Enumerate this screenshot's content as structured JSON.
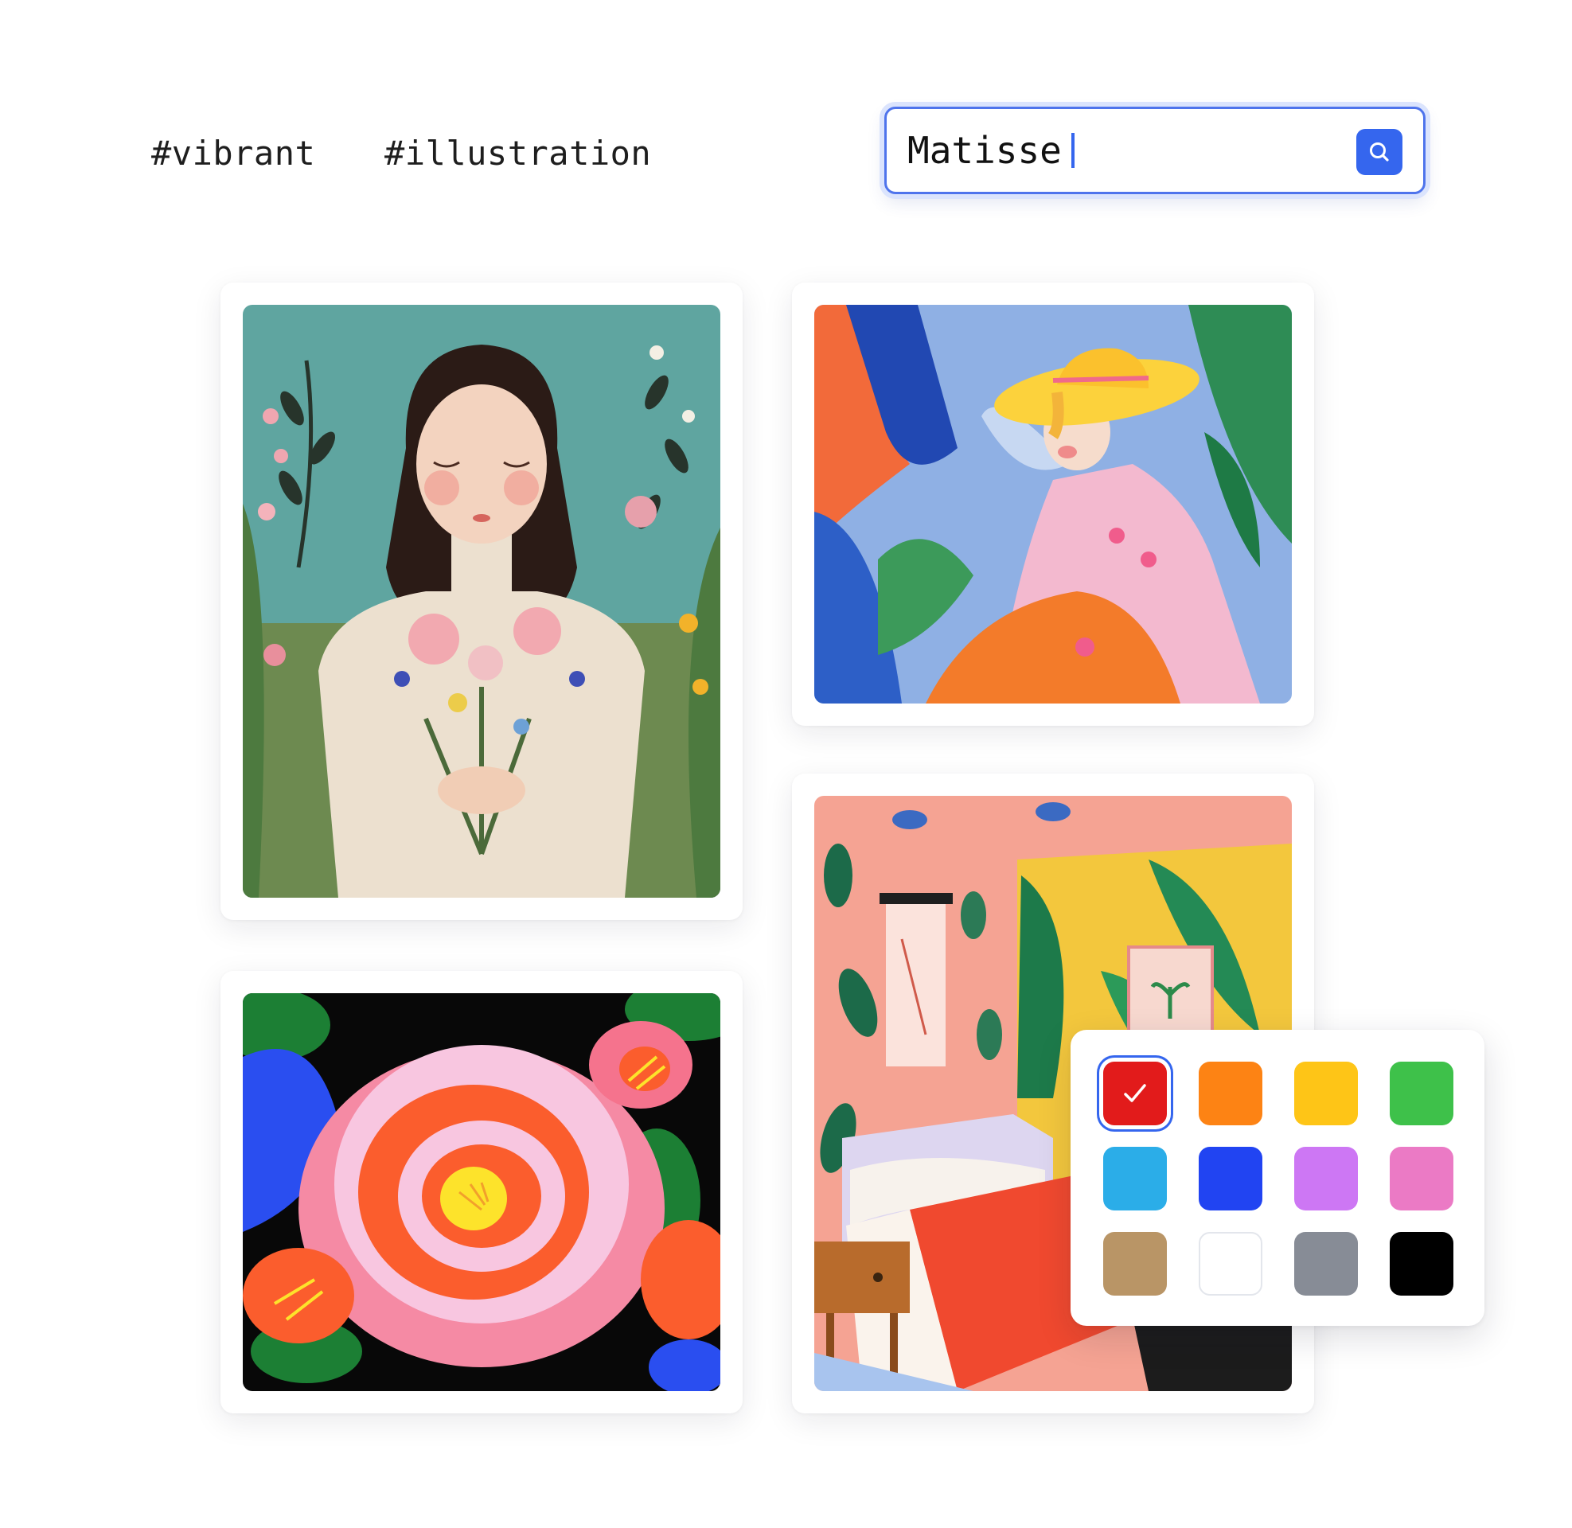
{
  "tags": [
    {
      "label": "#vibrant"
    },
    {
      "label": "#illustration"
    }
  ],
  "search": {
    "value": "Matisse",
    "icon": "search-icon",
    "accent_color": "#3566ee"
  },
  "gallery": {
    "images": [
      {
        "subject": "girl with closed eyes holding a flower bouquet among wildflowers"
      },
      {
        "subject": "woman in a yellow sun hat sitting among blue tropical leaves"
      },
      {
        "subject": "large pink and orange flower on a black background"
      },
      {
        "subject": "colorful bedroom interior with leafy wallpaper"
      }
    ]
  },
  "color_picker": {
    "selected": "red",
    "selected_icon": "checkmark-icon",
    "colors": [
      {
        "name": "red",
        "hex": "#e21b1b"
      },
      {
        "name": "orange",
        "hex": "#fd8314"
      },
      {
        "name": "yellow",
        "hex": "#fec517"
      },
      {
        "name": "green",
        "hex": "#3ec14a"
      },
      {
        "name": "light-blue",
        "hex": "#2bade8"
      },
      {
        "name": "blue",
        "hex": "#2144f2"
      },
      {
        "name": "purple",
        "hex": "#cd77f4"
      },
      {
        "name": "pink",
        "hex": "#eb7ac5"
      },
      {
        "name": "tan",
        "hex": "#b99566"
      },
      {
        "name": "white",
        "hex": "#ffffff"
      },
      {
        "name": "gray",
        "hex": "#878c96"
      },
      {
        "name": "black",
        "hex": "#000000"
      }
    ]
  }
}
